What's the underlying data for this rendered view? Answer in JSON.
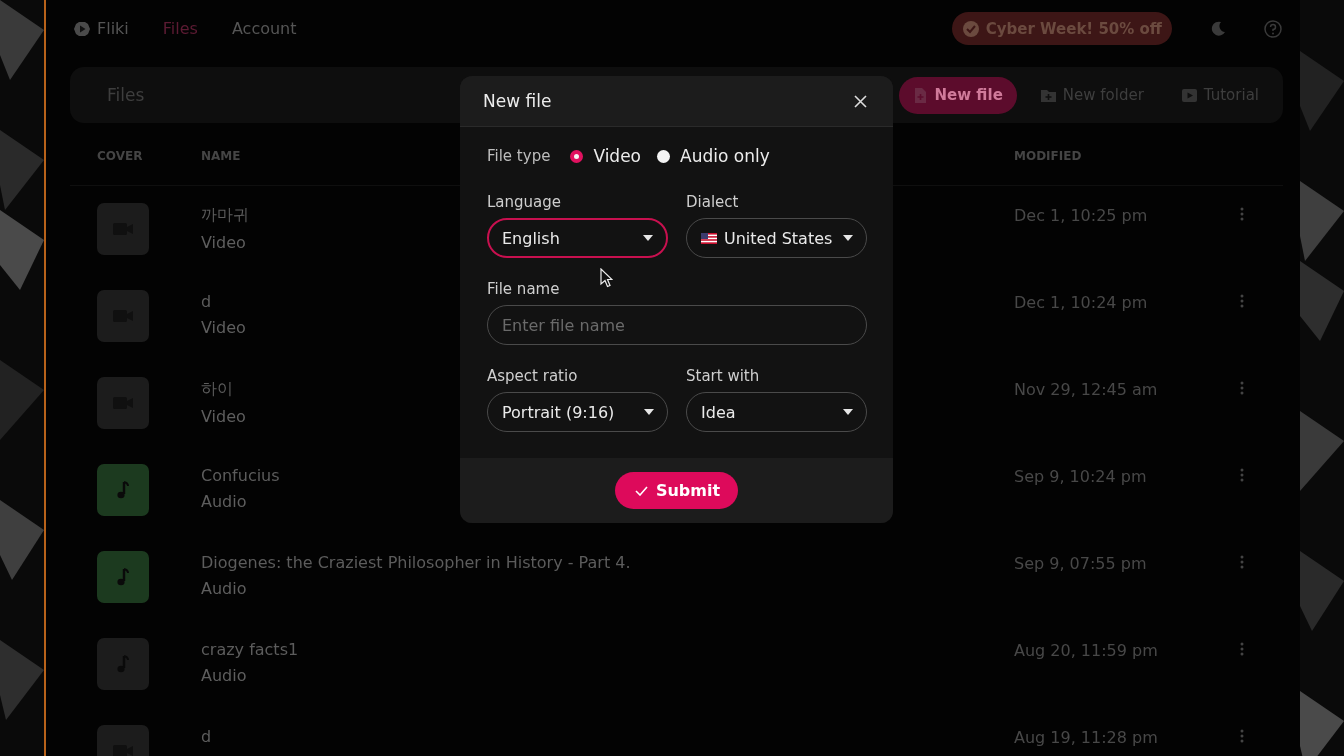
{
  "nav": {
    "brand": "Fliki",
    "links": [
      {
        "label": "Files",
        "selected": true
      },
      {
        "label": "Account",
        "selected": false
      }
    ],
    "promo": "Cyber Week! 50% off"
  },
  "toolbar": {
    "title": "Files",
    "actions": [
      {
        "label": "New file",
        "kind": "primary"
      },
      {
        "label": "New folder",
        "kind": "folder"
      },
      {
        "label": "Tutorial",
        "kind": "video"
      }
    ]
  },
  "table": {
    "columns": [
      "COVER",
      "NAME",
      "MODIFIED"
    ],
    "rows": [
      {
        "name": "까마귀",
        "type": "Video",
        "modified": "Dec 1, 10:25 pm",
        "kind": "video",
        "color": "#1c1c1c"
      },
      {
        "name": "d",
        "type": "Video",
        "modified": "Dec 1, 10:24 pm",
        "kind": "video",
        "color": "#1c1c1c"
      },
      {
        "name": "하이",
        "type": "Video",
        "modified": "Nov 29, 12:45 am",
        "kind": "video",
        "color": "#1c1c1c"
      },
      {
        "name": "Confucius",
        "type": "Audio",
        "modified": "Sep 9, 10:24 pm",
        "kind": "audio",
        "color": "#1c3a1f"
      },
      {
        "name": "Diogenes: the Craziest Philosopher in History - Part 4.",
        "type": "Audio",
        "modified": "Sep 9, 07:55 pm",
        "kind": "audio",
        "color": "#1c3a1f"
      },
      {
        "name": "crazy facts1",
        "type": "Audio",
        "modified": "Aug 20, 11:59 pm",
        "kind": "audio",
        "color": "#1c1c1c"
      },
      {
        "name": "d",
        "modified": "Aug 19, 11:28 pm",
        "kind": "video",
        "color": "#1c1c1c"
      }
    ]
  },
  "dialog": {
    "title": "New file",
    "file_type": {
      "label": "File type",
      "options": [
        {
          "label": "Video",
          "selected": true
        },
        {
          "label": "Audio only",
          "selected": false
        }
      ]
    },
    "fields": [
      {
        "label": "Language",
        "value": "English",
        "kind": "select",
        "focused": true
      },
      {
        "label": "Dialect",
        "value": "United States",
        "kind": "flag_select",
        "focused": false
      },
      {
        "label": "File name",
        "placeholder": "Enter file name",
        "kind": "text",
        "focused": false
      },
      {
        "label": "Aspect ratio",
        "value": "Portrait (9:16)",
        "kind": "select",
        "focused": false
      },
      {
        "label": "Start with",
        "value": "Idea",
        "kind": "select",
        "focused": false
      }
    ],
    "submit": "Submit"
  }
}
